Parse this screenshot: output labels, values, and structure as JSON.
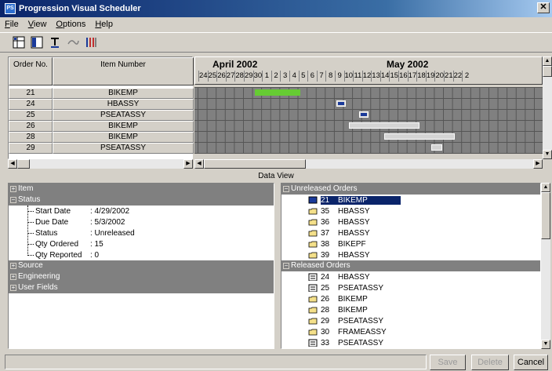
{
  "window": {
    "title": "Progression Visual Scheduler",
    "icon_text": "PS"
  },
  "menu": [
    "File",
    "View",
    "Options",
    "Help"
  ],
  "grid": {
    "col_order": "Order No.",
    "col_item": "Item Number",
    "rows": [
      {
        "order": "21",
        "item": "BIKEMP"
      },
      {
        "order": "24",
        "item": "HBASSY"
      },
      {
        "order": "25",
        "item": "PSEATASSY"
      },
      {
        "order": "26",
        "item": "BIKEMP"
      },
      {
        "order": "28",
        "item": "BIKEMP"
      },
      {
        "order": "29",
        "item": "PSEATASSY"
      }
    ],
    "months": [
      "April 2002",
      "May 2002"
    ],
    "days": [
      "24",
      "25",
      "26",
      "27",
      "28",
      "29",
      "30",
      "1",
      "2",
      "3",
      "4",
      "5",
      "6",
      "7",
      "8",
      "9",
      "10",
      "11",
      "12",
      "13",
      "14",
      "15",
      "16",
      "17",
      "18",
      "19",
      "20",
      "21",
      "22",
      "2"
    ],
    "bar_colors": {
      "selected": "#66cc33",
      "normal": "#d4d4d4",
      "marker": "#1a3a9a"
    }
  },
  "data_view": {
    "label": "Data View",
    "tree_sections": {
      "item": "Item",
      "status": "Status",
      "source": "Source",
      "engineering": "Engineering",
      "user_fields": "User Fields"
    },
    "status_fields": [
      {
        "label": "Start Date",
        "value": ": 4/29/2002"
      },
      {
        "label": "Due Date",
        "value": ": 5/3/2002"
      },
      {
        "label": "Status",
        "value": ": Unreleased"
      },
      {
        "label": "Qty Ordered",
        "value": ": 15"
      },
      {
        "label": "Qty Reported",
        "value": ": 0"
      }
    ],
    "unreleased_header": "Unreleased Orders",
    "unreleased": [
      {
        "num": "21",
        "item": "BIKEMP"
      },
      {
        "num": "35",
        "item": "HBASSY"
      },
      {
        "num": "36",
        "item": "HBASSY"
      },
      {
        "num": "37",
        "item": "HBASSY"
      },
      {
        "num": "38",
        "item": "BIKEPF"
      },
      {
        "num": "39",
        "item": "HBASSY"
      }
    ],
    "released_header": "Released Orders",
    "released": [
      {
        "num": "24",
        "item": "HBASSY"
      },
      {
        "num": "25",
        "item": "PSEATASSY"
      },
      {
        "num": "26",
        "item": "BIKEMP"
      },
      {
        "num": "28",
        "item": "BIKEMP"
      },
      {
        "num": "29",
        "item": "PSEATASSY"
      },
      {
        "num": "30",
        "item": "FRAMEASSY"
      },
      {
        "num": "33",
        "item": "PSEATASSY"
      }
    ]
  },
  "buttons": {
    "save": "Save",
    "delete": "Delete",
    "cancel": "Cancel"
  }
}
